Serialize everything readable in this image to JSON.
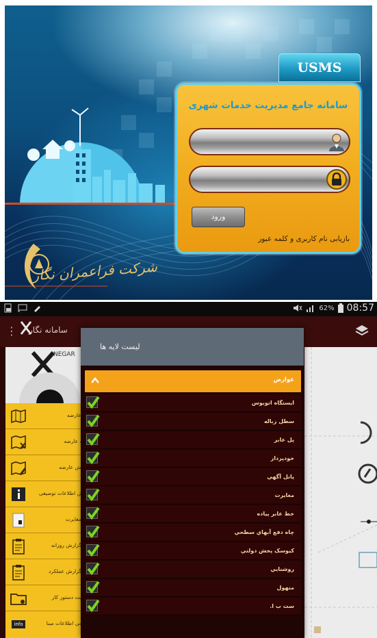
{
  "login_screen": {
    "brand_tab": "USMS",
    "card_title": "سامانه جامع مدیریت خدمات شهری",
    "username_icon": "user-icon",
    "password_icon": "lock-icon",
    "login_button": "ورود",
    "recover_link": "بازیابی نام کاربری و کلمه عبور",
    "company_name": "شرکت فراعمران نگار"
  },
  "status_bar": {
    "battery": "62%",
    "time": "08:57"
  },
  "app_bar": {
    "title": "سامانه نگار",
    "subtitle": "نگار",
    "menu_icon": "overflow-menu-icon",
    "layers_icon": "layers-icon"
  },
  "drawer": {
    "header_text": "NEGAR",
    "items": [
      {
        "label": "درج عارضه",
        "icon": "map-add-icon"
      },
      {
        "label": "حذف عارضه",
        "icon": "map-delete-icon"
      },
      {
        "label": "ویرایش عارضه",
        "icon": "map-edit-icon"
      },
      {
        "label": "نمایش اطلاعات توصیفی",
        "icon": "info-icon"
      },
      {
        "label": "ثبت مغایرت",
        "icon": "conflict-icon"
      },
      {
        "label": "ثبت گزارش روزانه",
        "icon": "clipboard-icon"
      },
      {
        "label": "ثبت گزارش عملکرد",
        "icon": "clipboard-icon"
      },
      {
        "label": "مدیریت دستور کار",
        "icon": "folder-icon"
      },
      {
        "label": "خروجی اطلاعات مبنا",
        "icon": "info-badge-icon"
      }
    ],
    "last_badge": "info"
  },
  "layers_dialog": {
    "title": "لیست لایه ها",
    "group": "عوارض",
    "layers": [
      {
        "label": "ایستگاه اتوبوس",
        "checked": true
      },
      {
        "label": "سطل زباله",
        "checked": true
      },
      {
        "label": "پل عابر",
        "checked": true
      },
      {
        "label": "خودپرداز",
        "checked": true
      },
      {
        "label": "پانل آگهي",
        "checked": true
      },
      {
        "label": "مغایرت",
        "checked": true
      },
      {
        "label": "خط عابر پیاده",
        "checked": true
      },
      {
        "label": "چاه دفع آبهاي سطحي",
        "checked": true
      },
      {
        "label": "کیوسک پخش دولتي",
        "checked": true
      },
      {
        "label": "روشنایي",
        "checked": true
      },
      {
        "label": "منهول",
        "checked": true
      },
      {
        "label": "ست ب ا.",
        "checked": true
      }
    ]
  },
  "colors": {
    "card_orange": "#f2ad1f",
    "accent_cyan": "#1a9bd3",
    "drawer_yellow": "#f3c020",
    "group_orange": "#f5a21b",
    "checkbox_green": "#7bd421",
    "dark_maroon": "#2f0505"
  }
}
